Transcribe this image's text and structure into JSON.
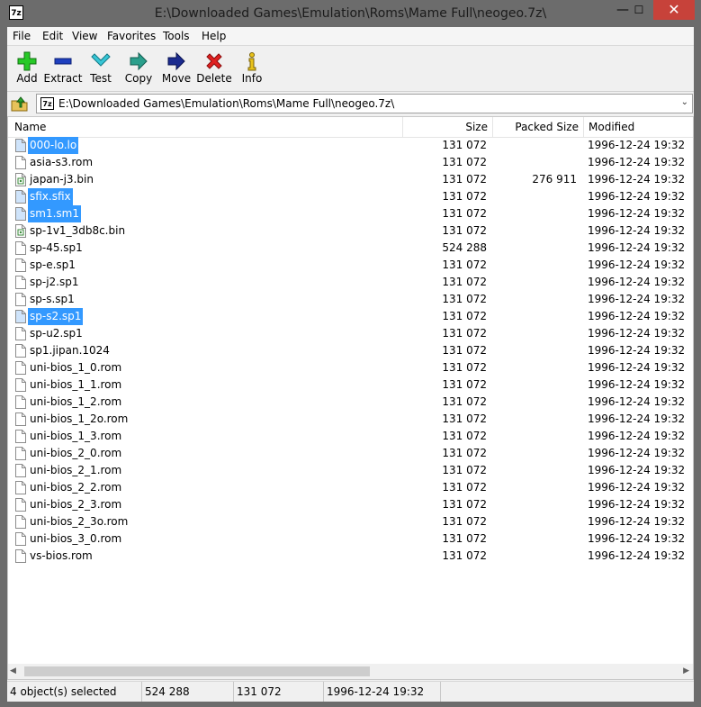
{
  "window": {
    "title": "E:\\Downloaded Games\\Emulation\\Roms\\Mame Full\\neogeo.7z\\",
    "app_icon": "7z",
    "minimize_glyph": "—",
    "maximize_glyph": "☐",
    "close_glyph": "✕"
  },
  "menu": [
    {
      "label": "File"
    },
    {
      "label": "Edit"
    },
    {
      "label": "View"
    },
    {
      "label": "Favorites"
    },
    {
      "label": "Tools"
    },
    {
      "label": "Help"
    }
  ],
  "toolbar": {
    "add": "Add",
    "extract": "Extract",
    "test": "Test",
    "copy": "Copy",
    "move": "Move",
    "delete": "Delete",
    "info": "Info"
  },
  "address": {
    "icon": "7z",
    "path": "E:\\Downloaded Games\\Emulation\\Roms\\Mame Full\\neogeo.7z\\",
    "dropdown_glyph": "⌄"
  },
  "columns": {
    "name": "Name",
    "size": "Size",
    "packed": "Packed Size",
    "modified": "Modified"
  },
  "files": [
    {
      "name": "000-lo.lo",
      "size": "131 072",
      "packed": "",
      "modified": "1996-12-24 19:32",
      "selected": true,
      "icon": "file-icon"
    },
    {
      "name": "asia-s3.rom",
      "size": "131 072",
      "packed": "",
      "modified": "1996-12-24 19:32",
      "selected": false,
      "icon": "file-icon"
    },
    {
      "name": "japan-j3.bin",
      "size": "131 072",
      "packed": "276 911",
      "modified": "1996-12-24 19:32",
      "selected": false,
      "icon": "binary-file-icon"
    },
    {
      "name": "sfix.sfix",
      "size": "131 072",
      "packed": "",
      "modified": "1996-12-24 19:32",
      "selected": true,
      "icon": "file-icon"
    },
    {
      "name": "sm1.sm1",
      "size": "131 072",
      "packed": "",
      "modified": "1996-12-24 19:32",
      "selected": true,
      "icon": "file-icon"
    },
    {
      "name": "sp-1v1_3db8c.bin",
      "size": "131 072",
      "packed": "",
      "modified": "1996-12-24 19:32",
      "selected": false,
      "icon": "binary-file-icon"
    },
    {
      "name": "sp-45.sp1",
      "size": "524 288",
      "packed": "",
      "modified": "1996-12-24 19:32",
      "selected": false,
      "icon": "file-icon"
    },
    {
      "name": "sp-e.sp1",
      "size": "131 072",
      "packed": "",
      "modified": "1996-12-24 19:32",
      "selected": false,
      "icon": "file-icon"
    },
    {
      "name": "sp-j2.sp1",
      "size": "131 072",
      "packed": "",
      "modified": "1996-12-24 19:32",
      "selected": false,
      "icon": "file-icon"
    },
    {
      "name": "sp-s.sp1",
      "size": "131 072",
      "packed": "",
      "modified": "1996-12-24 19:32",
      "selected": false,
      "icon": "file-icon"
    },
    {
      "name": "sp-s2.sp1",
      "size": "131 072",
      "packed": "",
      "modified": "1996-12-24 19:32",
      "selected": true,
      "icon": "file-icon"
    },
    {
      "name": "sp-u2.sp1",
      "size": "131 072",
      "packed": "",
      "modified": "1996-12-24 19:32",
      "selected": false,
      "icon": "file-icon"
    },
    {
      "name": "sp1.jipan.1024",
      "size": "131 072",
      "packed": "",
      "modified": "1996-12-24 19:32",
      "selected": false,
      "icon": "file-icon"
    },
    {
      "name": "uni-bios_1_0.rom",
      "size": "131 072",
      "packed": "",
      "modified": "1996-12-24 19:32",
      "selected": false,
      "icon": "file-icon"
    },
    {
      "name": "uni-bios_1_1.rom",
      "size": "131 072",
      "packed": "",
      "modified": "1996-12-24 19:32",
      "selected": false,
      "icon": "file-icon"
    },
    {
      "name": "uni-bios_1_2.rom",
      "size": "131 072",
      "packed": "",
      "modified": "1996-12-24 19:32",
      "selected": false,
      "icon": "file-icon"
    },
    {
      "name": "uni-bios_1_2o.rom",
      "size": "131 072",
      "packed": "",
      "modified": "1996-12-24 19:32",
      "selected": false,
      "icon": "file-icon"
    },
    {
      "name": "uni-bios_1_3.rom",
      "size": "131 072",
      "packed": "",
      "modified": "1996-12-24 19:32",
      "selected": false,
      "icon": "file-icon"
    },
    {
      "name": "uni-bios_2_0.rom",
      "size": "131 072",
      "packed": "",
      "modified": "1996-12-24 19:32",
      "selected": false,
      "icon": "file-icon"
    },
    {
      "name": "uni-bios_2_1.rom",
      "size": "131 072",
      "packed": "",
      "modified": "1996-12-24 19:32",
      "selected": false,
      "icon": "file-icon"
    },
    {
      "name": "uni-bios_2_2.rom",
      "size": "131 072",
      "packed": "",
      "modified": "1996-12-24 19:32",
      "selected": false,
      "icon": "file-icon"
    },
    {
      "name": "uni-bios_2_3.rom",
      "size": "131 072",
      "packed": "",
      "modified": "1996-12-24 19:32",
      "selected": false,
      "icon": "file-icon"
    },
    {
      "name": "uni-bios_2_3o.rom",
      "size": "131 072",
      "packed": "",
      "modified": "1996-12-24 19:32",
      "selected": false,
      "icon": "file-icon"
    },
    {
      "name": "uni-bios_3_0.rom",
      "size": "131 072",
      "packed": "",
      "modified": "1996-12-24 19:32",
      "selected": false,
      "icon": "file-icon"
    },
    {
      "name": "vs-bios.rom",
      "size": "131 072",
      "packed": "",
      "modified": "1996-12-24 19:32",
      "selected": false,
      "icon": "file-icon"
    }
  ],
  "status": {
    "selected": "4 object(s) selected",
    "total_size": "524 288",
    "focused_size": "131 072",
    "focused_modified": "1996-12-24 19:32"
  },
  "colors": {
    "selection": "#3399ff",
    "title_bar": "#6c6c6c",
    "close_button": "#c7423a"
  }
}
